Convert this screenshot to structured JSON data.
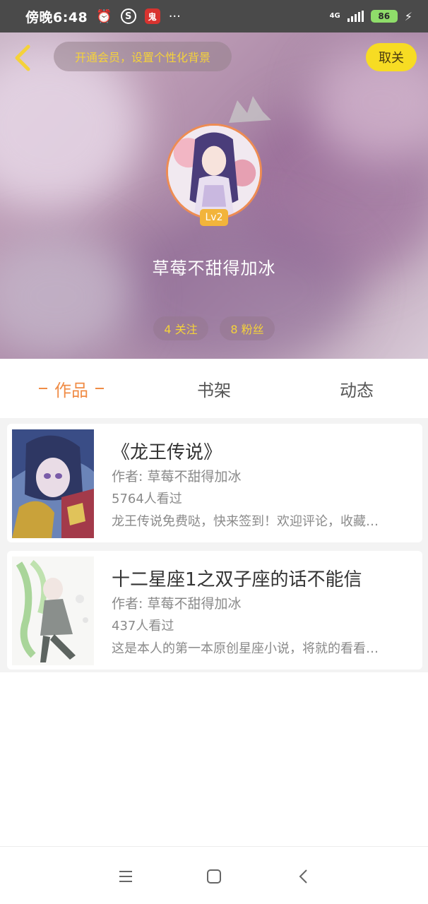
{
  "status_bar": {
    "time": "傍晚6:48",
    "icons": [
      "alarm-icon",
      "sogou-icon",
      "app-notification-icon",
      "more-dots-icon"
    ],
    "network": "4G",
    "battery": "86"
  },
  "header": {
    "vip_banner": "开通会员，设置个性化背景",
    "follow_button": "取关",
    "level": "Lv2",
    "username": "草莓不甜得加冰",
    "following": "4 关注",
    "fans": "8 粉丝"
  },
  "tabs": [
    {
      "label": "作品",
      "active": true
    },
    {
      "label": "书架",
      "active": false
    },
    {
      "label": "动态",
      "active": false
    }
  ],
  "works": [
    {
      "title": "《龙王传说》",
      "author": "作者: 草莓不甜得加冰",
      "views": "5764人看过",
      "description": "龙王传说免费哒，快来签到！欢迎评论，收藏…"
    },
    {
      "title": "十二星座1之双子座的话不能信",
      "author": "作者: 草莓不甜得加冰",
      "views": "437人看过",
      "description": "这是本人的第一本原创星座小说，将就的看看…"
    }
  ],
  "colors": {
    "accent": "#f08c46",
    "follow_button_bg": "#f7dc23",
    "banner_text": "#f5d23a"
  }
}
